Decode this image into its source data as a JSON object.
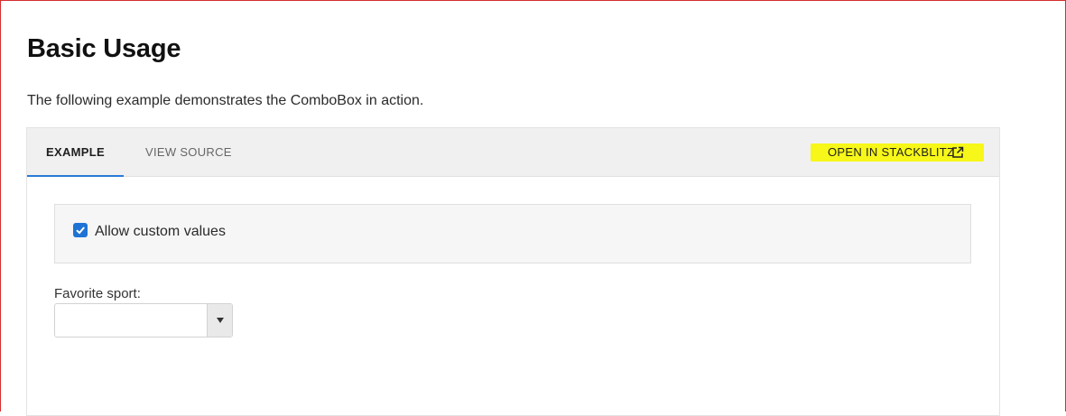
{
  "page": {
    "title": "Basic Usage",
    "intro": "The following example demonstrates the ComboBox in action."
  },
  "demo": {
    "tabs": [
      {
        "label": "EXAMPLE",
        "active": true
      },
      {
        "label": "VIEW SOURCE",
        "active": false
      }
    ],
    "stackblitz_label": "OPEN IN STACKBLITZ",
    "stackblitz_icon": "external-link-icon",
    "highlight_color": "#f7f719",
    "accent_color": "#2a7ad6"
  },
  "options": {
    "allow_custom_label": "Allow custom values",
    "allow_custom_checked": true
  },
  "combobox": {
    "label": "Favorite sport:",
    "value": "",
    "dropdown_icon": "caret-down-icon"
  }
}
